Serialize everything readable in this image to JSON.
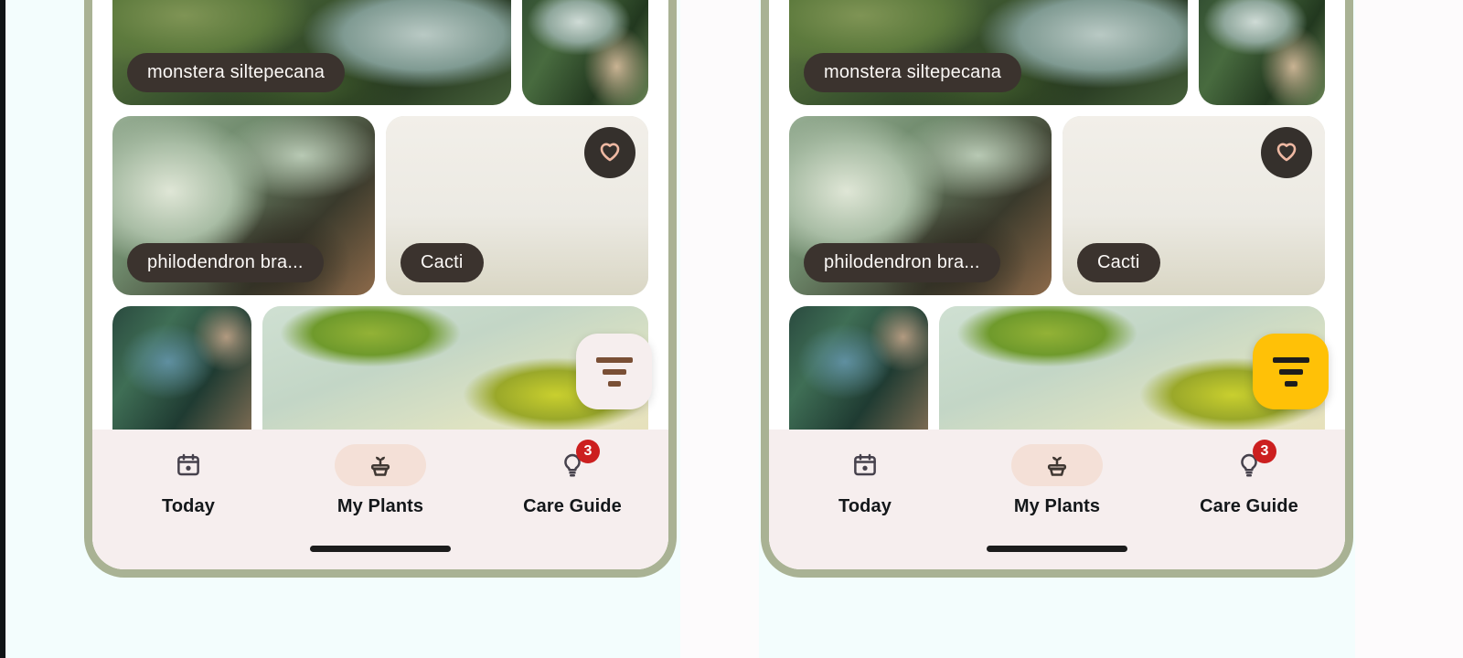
{
  "theme": {
    "page_background": "#f3fdfd",
    "gutter": "#fdfbfc",
    "frame_border": "#a9b294",
    "nav_background": "#f6eeee",
    "chip_background": "#3b332e",
    "chip_text": "#fbf8f6",
    "accent_fab": "#ffc107",
    "light_fab": "#f6eeee",
    "badge": "#cc1f1f",
    "heart_outline": "#efb9a3",
    "active_pill": "#f4e0d7",
    "edge_strip": "#101416"
  },
  "screens": [
    {
      "id": "screen-light-fab",
      "fab": {
        "name": "filter-fab",
        "style": "light",
        "icon": "filter-icon"
      },
      "grid": {
        "rows": [
          {
            "cards": [
              {
                "name": "monstera-siltepecana",
                "label": "monstera siltepecana",
                "image": "img-monstera",
                "favorite": false,
                "truncated": false
              },
              {
                "name": "palm-plant",
                "label": "",
                "image": "img-palm",
                "favorite": false,
                "truncated": false
              }
            ]
          },
          {
            "cards": [
              {
                "name": "philodendron-brandtianum",
                "label": "philodendron bra...",
                "image": "img-philo",
                "favorite": false,
                "truncated": true
              },
              {
                "name": "cacti",
                "label": "Cacti",
                "image": "img-cacti",
                "favorite": true,
                "truncated": false
              }
            ]
          },
          {
            "cards": [
              {
                "name": "lady-palm",
                "label": "",
                "image": "img-lady-palm",
                "favorite": false,
                "truncated": false
              },
              {
                "name": "maple-leaf-plant",
                "label": "",
                "image": "img-maple",
                "favorite": false,
                "truncated": false
              }
            ]
          }
        ]
      },
      "nav": {
        "items": [
          {
            "name": "today",
            "label": "Today",
            "icon": "calendar-icon",
            "active": false,
            "badge": null
          },
          {
            "name": "my-plants",
            "label": "My Plants",
            "icon": "potted-plant-icon",
            "active": true,
            "badge": null
          },
          {
            "name": "care-guide",
            "label": "Care Guide",
            "icon": "lightbulb-icon",
            "active": false,
            "badge": "3"
          }
        ]
      }
    },
    {
      "id": "screen-accent-fab",
      "fab": {
        "name": "filter-fab",
        "style": "accent",
        "icon": "filter-icon"
      },
      "grid": {
        "rows": [
          {
            "cards": [
              {
                "name": "monstera-siltepecana",
                "label": "monstera siltepecana",
                "image": "img-monstera",
                "favorite": false,
                "truncated": false
              },
              {
                "name": "palm-plant",
                "label": "",
                "image": "img-palm",
                "favorite": false,
                "truncated": false
              }
            ]
          },
          {
            "cards": [
              {
                "name": "philodendron-brandtianum",
                "label": "philodendron bra...",
                "image": "img-philo",
                "favorite": false,
                "truncated": true
              },
              {
                "name": "cacti",
                "label": "Cacti",
                "image": "img-cacti",
                "favorite": true,
                "truncated": false
              }
            ]
          },
          {
            "cards": [
              {
                "name": "lady-palm",
                "label": "",
                "image": "img-lady-palm",
                "favorite": false,
                "truncated": false
              },
              {
                "name": "maple-leaf-plant",
                "label": "",
                "image": "img-maple",
                "favorite": false,
                "truncated": false
              }
            ]
          }
        ]
      },
      "nav": {
        "items": [
          {
            "name": "today",
            "label": "Today",
            "icon": "calendar-icon",
            "active": false,
            "badge": null
          },
          {
            "name": "my-plants",
            "label": "My Plants",
            "icon": "potted-plant-icon",
            "active": true,
            "badge": null
          },
          {
            "name": "care-guide",
            "label": "Care Guide",
            "icon": "lightbulb-icon",
            "active": false,
            "badge": "3"
          }
        ]
      }
    }
  ]
}
